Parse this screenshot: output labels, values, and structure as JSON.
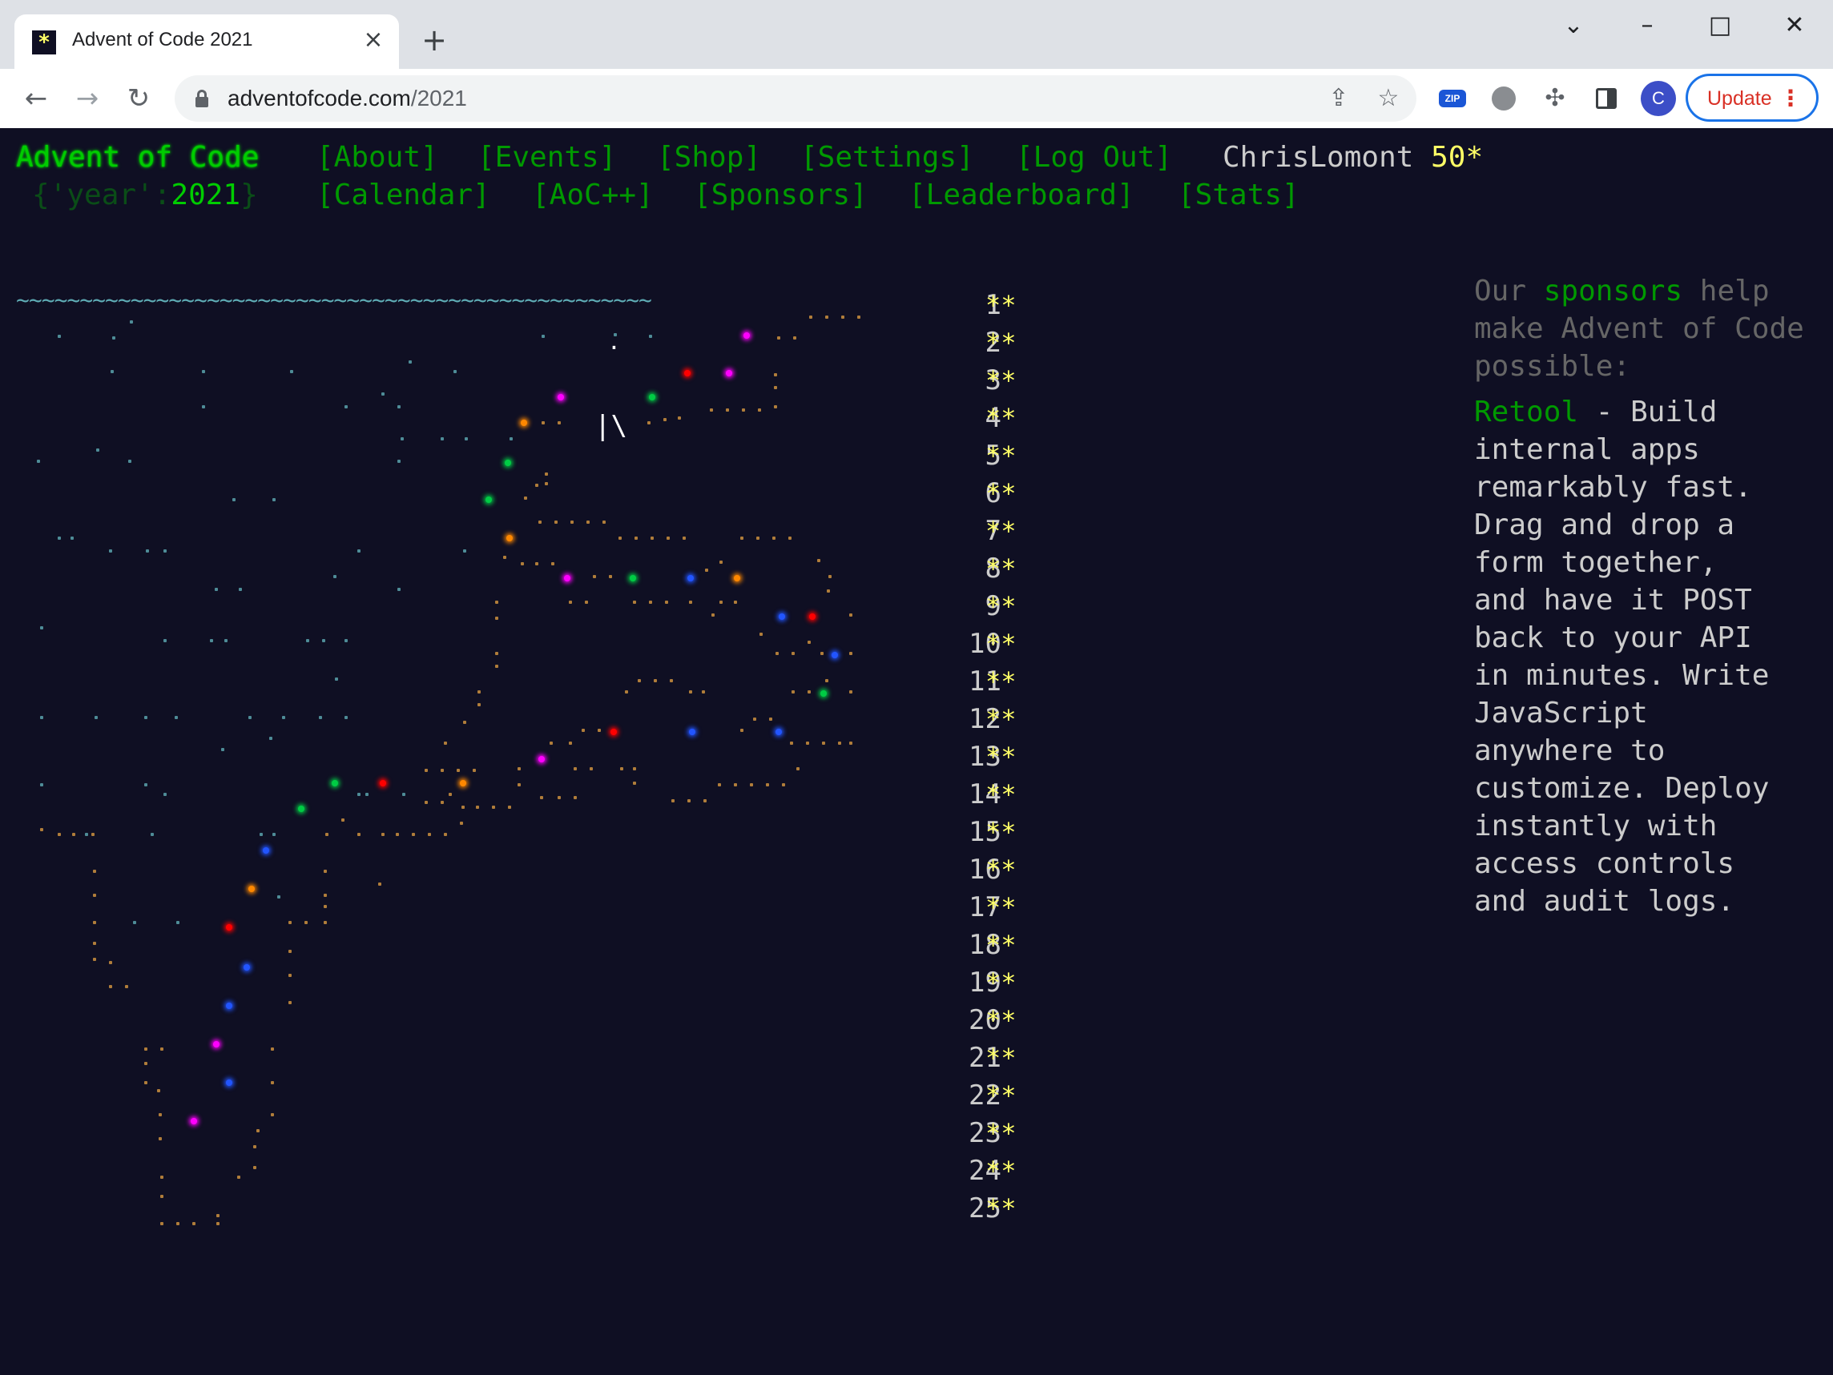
{
  "browser": {
    "tab_title": "Advent of Code 2021",
    "tab_icon": "star-favicon",
    "url_host": "adventofcode.com",
    "url_path": "/2021",
    "extension_label": "ZIP",
    "avatar_letter": "C",
    "update_label": "Update"
  },
  "header": {
    "site_title": "Advent of Code",
    "event_prefix": "{'year':",
    "event_year": "2021",
    "event_suffix": "}",
    "nav_row1": [
      "[About]",
      "[Events]",
      "[Shop]",
      "[Settings]",
      "[Log Out]"
    ],
    "nav_row2": [
      "[Calendar]",
      "[AoC++]",
      "[Sponsors]",
      "[Leaderboard]",
      "[Stats]"
    ],
    "user_name": "ChrisLomont",
    "user_stars": "50*"
  },
  "calendar": {
    "days": [
      "1",
      "2",
      "3",
      "4",
      "5",
      "6",
      "7",
      "8",
      "9",
      "10",
      "11",
      "12",
      "13",
      "14",
      "15",
      "16",
      "17",
      "18",
      "19",
      "20",
      "21",
      "22",
      "23",
      "24",
      "25"
    ],
    "stars": "**"
  },
  "sponsor": {
    "intro_before": "Our",
    "intro_link": "sponsors",
    "intro_after": "help make Advent of Code possible:",
    "name": "Retool",
    "text_lines": [
      " - Build",
      "internal apps",
      "remarkably fast.",
      "Drag and drop a",
      "form together,",
      "and have it POST",
      "back to your API",
      "in minutes. Write",
      "JavaScript",
      "anywhere to",
      "customize. Deploy",
      "instantly with",
      "access controls",
      "and audit logs."
    ]
  },
  "colors": {
    "background": "#0f0f23",
    "green": "#00cc00",
    "nav_green": "#009900",
    "star_yellow": "#ffff66",
    "text": "#cccccc",
    "wave_cyan": "#5eabb4"
  }
}
